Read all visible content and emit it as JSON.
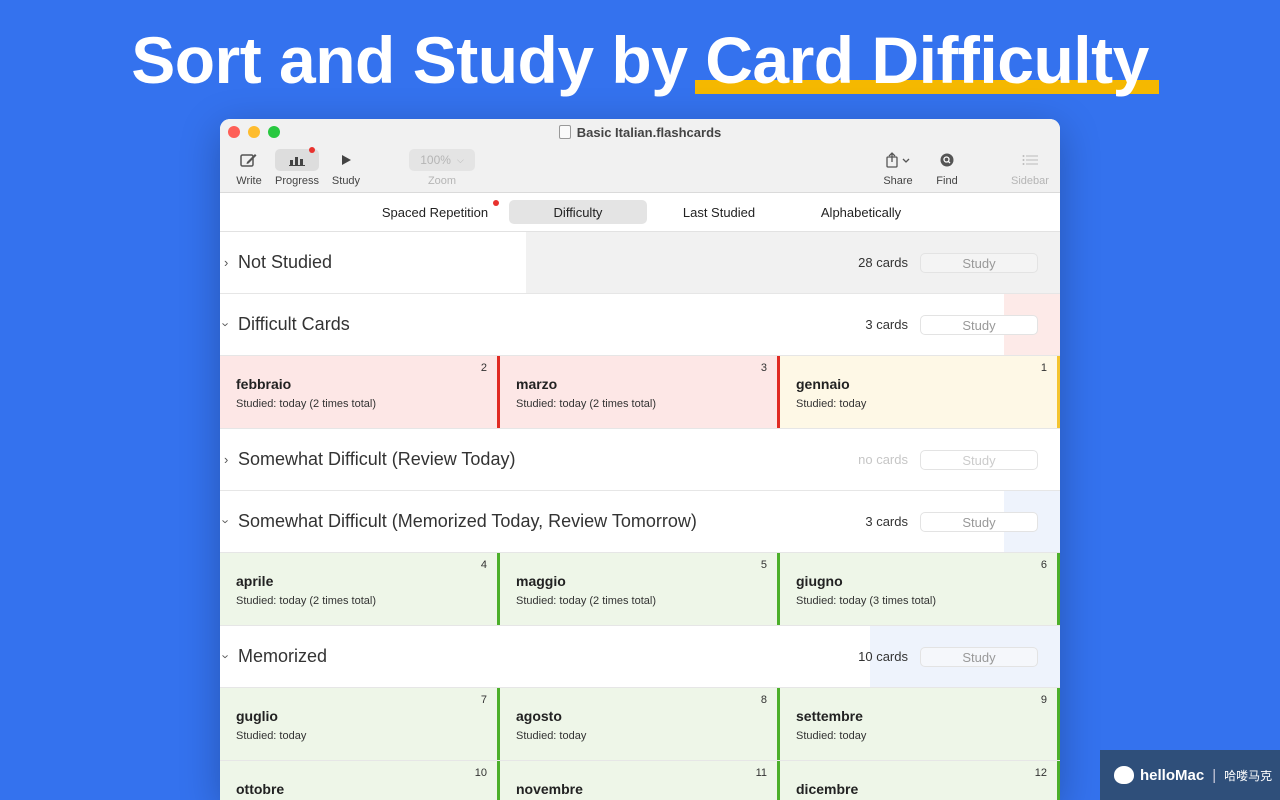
{
  "headline": {
    "prefix": "Sort and Study by ",
    "highlight": "Card Difficulty"
  },
  "window": {
    "title": "Basic Italian.flashcards",
    "toolbar": {
      "write": "Write",
      "progress": "Progress",
      "study": "Study",
      "zoom_value": "100%",
      "zoom_label": "Zoom",
      "share": "Share",
      "find": "Find",
      "sidebar": "Sidebar"
    },
    "segments": [
      "Spaced Repetition",
      "Difficulty",
      "Last Studied",
      "Alphabetically"
    ],
    "selected_segment": "Difficulty",
    "groups": [
      {
        "title": "Not Studied",
        "count": "28 cards",
        "study": "Study",
        "expanded": false
      },
      {
        "title": "Difficult Cards",
        "count": "3 cards",
        "study": "Study",
        "expanded": true
      },
      {
        "title": "Somewhat Difficult (Review Today)",
        "count": "no cards",
        "study": "Study",
        "expanded": false
      },
      {
        "title": "Somewhat Difficult (Memorized Today, Review Tomorrow)",
        "count": "3 cards",
        "study": "Study",
        "expanded": true
      },
      {
        "title": "Memorized",
        "count": "10 cards",
        "study": "Study",
        "expanded": true
      }
    ],
    "difficult_cards": [
      {
        "name": "febbraio",
        "info": "Studied: today (2 times total)",
        "num": "2",
        "color": "#E02B23"
      },
      {
        "name": "marzo",
        "info": "Studied: today (2 times total)",
        "num": "3",
        "color": "#E02B23"
      },
      {
        "name": "gennaio",
        "info": "Studied: today",
        "num": "1",
        "color": "#F4C430"
      }
    ],
    "somewhat_cards": [
      {
        "name": "aprile",
        "info": "Studied: today (2 times total)",
        "num": "4"
      },
      {
        "name": "maggio",
        "info": "Studied: today (2 times total)",
        "num": "5"
      },
      {
        "name": "giugno",
        "info": "Studied: today (3 times total)",
        "num": "6"
      }
    ],
    "memorized_cards": [
      {
        "name": "guglio",
        "info": "Studied: today",
        "num": "7"
      },
      {
        "name": "agosto",
        "info": "Studied: today",
        "num": "8"
      },
      {
        "name": "settembre",
        "info": "Studied: today",
        "num": "9"
      },
      {
        "name": "ottobre",
        "info": "",
        "num": "10"
      },
      {
        "name": "novembre",
        "info": "",
        "num": "11"
      },
      {
        "name": "dicembre",
        "info": "",
        "num": "12"
      }
    ]
  },
  "watermark": {
    "brand": "helloMac",
    "separator": "|",
    "cn": "哈喽马克"
  },
  "colors": {
    "background": "#3472EE",
    "highlight": "#F5B800",
    "red": "#E02B23",
    "yellow": "#F4C430",
    "green": "#4CAF2A"
  }
}
